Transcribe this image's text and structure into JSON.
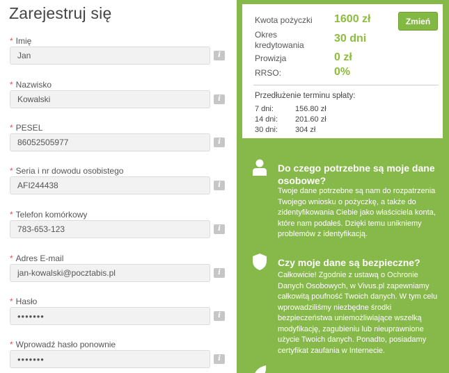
{
  "form": {
    "title": "Zarejestruj się",
    "required_mark": "*",
    "info_icon": "i",
    "fields": [
      {
        "label": "Imię",
        "value": "Jan"
      },
      {
        "label": "Nazwisko",
        "value": "Kowalski"
      },
      {
        "label": "PESEL",
        "value": "86052505977"
      },
      {
        "label": "Seria i nr dowodu osobistego",
        "value": "AFI244438"
      },
      {
        "label": "Telefon komórkowy",
        "value": "783-653-123"
      },
      {
        "label": "Adres E-mail",
        "value": "jan-kowalski@pocztabis.pl"
      },
      {
        "label": "Hasło",
        "value": "•••••••"
      },
      {
        "label": "Wprowadź hasło ponownie",
        "value": "•••••••"
      }
    ]
  },
  "summary": {
    "rows": [
      {
        "label": "Kwota pożyczki",
        "value": "1600 zł"
      },
      {
        "label": "Okres kredytowania",
        "value": "30 dni"
      },
      {
        "label": "Prowizja",
        "value": "0 zł"
      },
      {
        "label": "RRSO:",
        "value": "0%"
      }
    ],
    "change_label": "Zmień",
    "extension_title": "Przedłużenie terminu spłaty:",
    "extensions": [
      {
        "label": "7 dni:",
        "value": "156.80 zł"
      },
      {
        "label": "14 dni:",
        "value": "201.60 zł"
      },
      {
        "label": "30 dni:",
        "value": "304 zł"
      }
    ]
  },
  "faq": [
    {
      "icon": "person-icon",
      "title": "Do czego potrzebne są moje dane osobowe?",
      "text": "Twoje dane potrzebne są nam do rozpatrzenia Twojego wniosku o pożyczkę, a także do zidentyfikowania Ciebie jako właściciela konta, które nam podałeś. Dzięki temu unikniemy problemów z identyfikacją."
    },
    {
      "icon": "shield-icon",
      "title": "Czy moje dane są bezpieczne?",
      "text": "Całkowicie! Zgodnie z ustawą o Ochronie Danych Osobowych, w Vivus.pl zapewniamy całkowitą poufność Twoich danych. W tym celu wprowadziliśmy niezbędne środki bezpieczeństwa uniemożliwiające wszelką modyfikację, zagubieniu lub nieuprawnione użycie Twoich danych. Ponadto, posiadamy certyfikat zaufania w Internecie."
    }
  ],
  "colors": {
    "panel_green": "#86b84a",
    "value_green": "#8cbd3e",
    "required_red": "#d9534f"
  }
}
